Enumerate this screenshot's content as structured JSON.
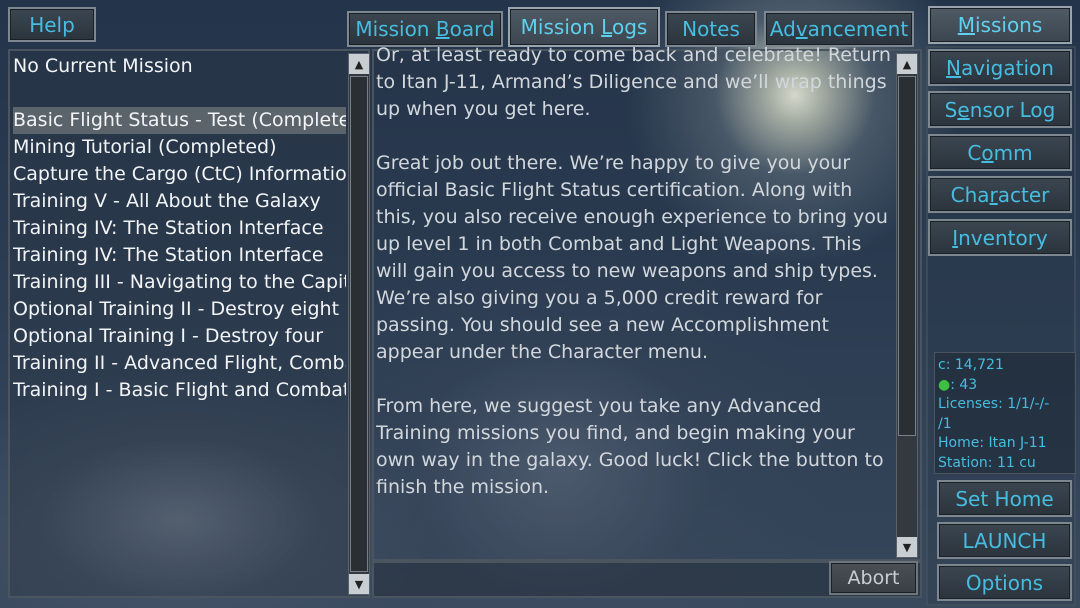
{
  "top_bar": {
    "help_label": "Help",
    "tabs": [
      {
        "label_pre": "Mission ",
        "label_key": "B",
        "label_post": "oard"
      },
      {
        "label_pre": "Mission ",
        "label_key": "L",
        "label_post": "ogs"
      },
      {
        "label_pre": "Notes",
        "label_key": "",
        "label_post": ""
      },
      {
        "label_pre": "Ad",
        "label_key": "v",
        "label_post": "ancement"
      }
    ],
    "missions_label_key": "M",
    "missions_label_post": "issions"
  },
  "side_menu": [
    {
      "label_pre": "",
      "label_key": "N",
      "label_post": "avigation"
    },
    {
      "label_pre": "S",
      "label_key": "e",
      "label_post": "nsor Log"
    },
    {
      "label_pre": "C",
      "label_key": "o",
      "label_post": "mm"
    },
    {
      "label_pre": "Cha",
      "label_key": "r",
      "label_post": "acter"
    },
    {
      "label_pre": "",
      "label_key": "I",
      "label_post": "nventory"
    }
  ],
  "mission_list": {
    "current": "No Current Mission",
    "items": [
      "Basic Flight Status - Test (Completed)",
      "Mining Tutorial (Completed)",
      "Capture the Cargo (CtC) Information",
      "Training V - All About the Galaxy",
      "Training IV: The Station Interface",
      "Training IV: The Station Interface",
      "Training III - Navigating to the Capitol",
      "Optional Training II - Destroy eight",
      "Optional Training I - Destroy four",
      "Training II - Advanced Flight, Combat",
      "Training I - Basic Flight and Combat"
    ]
  },
  "mission_text": {
    "paragraphs": [
      "Or, at least ready to come back and celebrate! Return to Itan J-11, Armand’s Diligence and we’ll wrap things up when you get here.",
      "Great job out there. We’re happy to give you your official Basic Flight Status certification. Along with this, you also receive enough experience to bring you up level 1 in both Combat and Light Weapons. This will gain you access to new weapons and ship types. We’re also giving you a 5,000 credit reward for passing. You should see a new Accomplishment appear under the Character menu.",
      "From here, we suggest you take any Advanced Training missions you find, and begin making your own way in the galaxy. Good luck! Click the button to finish the mission."
    ]
  },
  "abort_label": "Abort",
  "stats": {
    "credits": "c: 14,721",
    "gems": ": 43",
    "licenses": "Licenses: 1/1/-/-",
    "licenses_cont": "/1",
    "home": "Home: Itan J-11",
    "station": "Station: 11 cu"
  },
  "bottom_buttons": {
    "set_home": "Set Home",
    "launch": "LAUNCH",
    "options": "Options"
  },
  "colors": {
    "accent": "#46bde0",
    "gem": "#3fbf3f"
  }
}
